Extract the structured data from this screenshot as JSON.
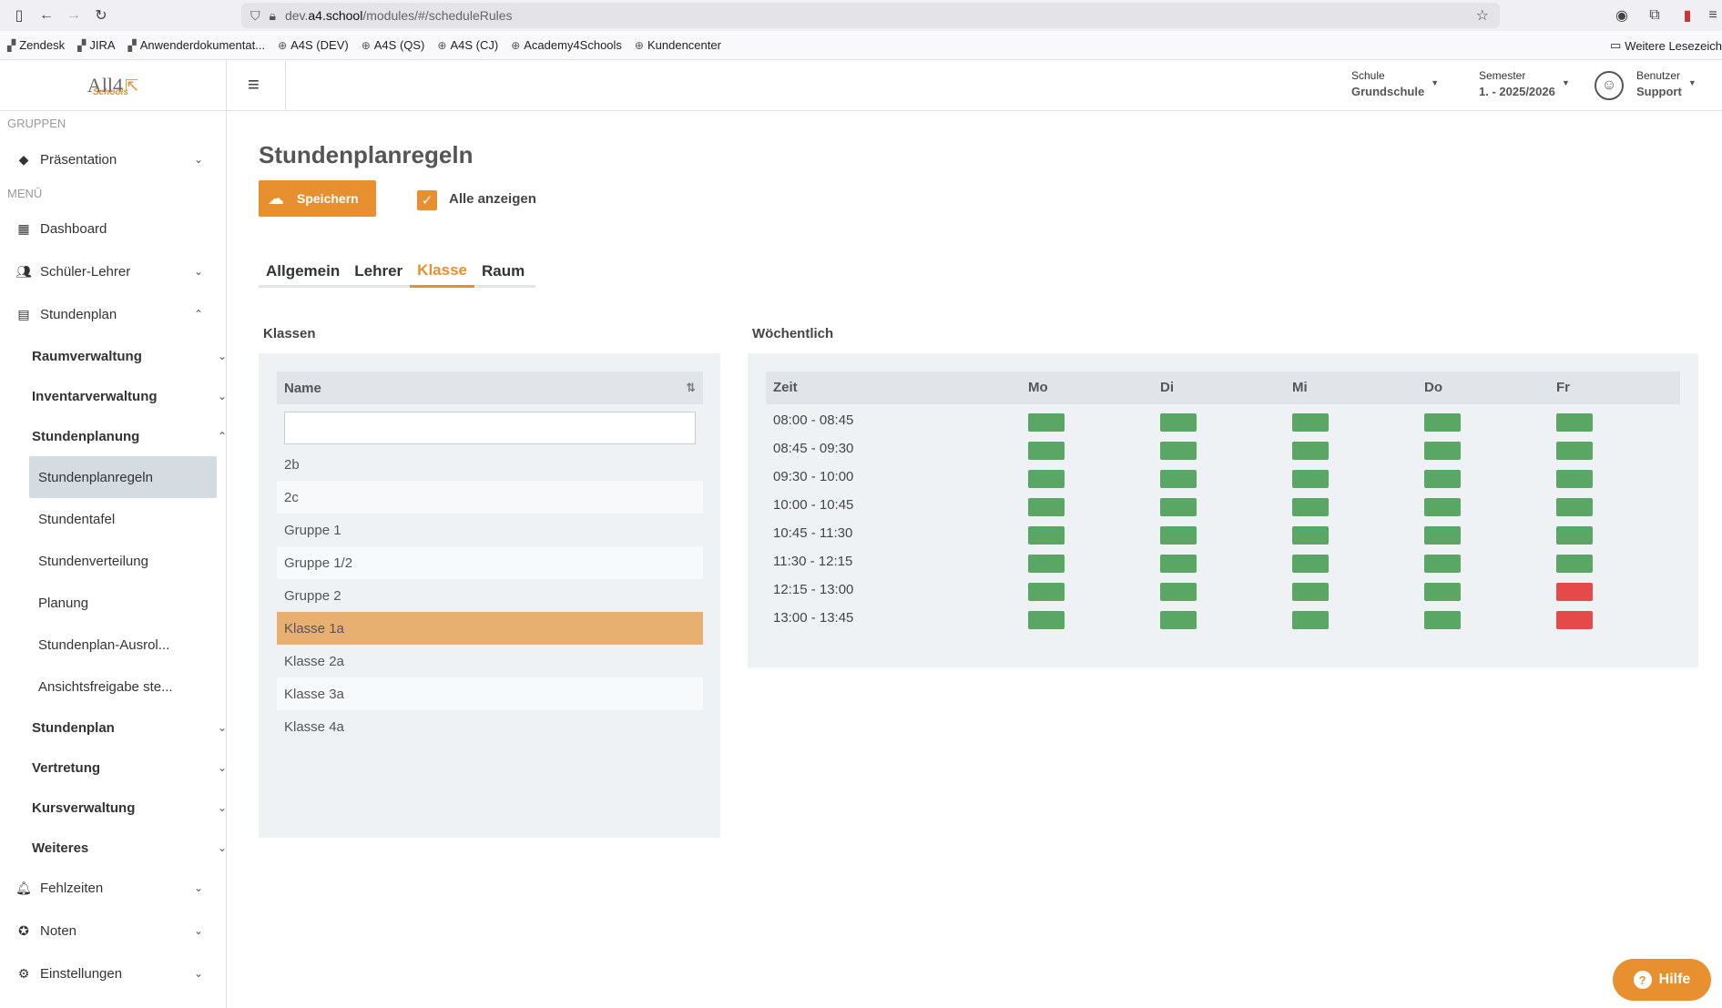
{
  "browser": {
    "url_prefix": "dev.",
    "url_host": "a4.school",
    "url_path": "/modules/#/scheduleRules",
    "bookmarks": [
      "Zendesk",
      "JIRA",
      "Anwenderdokumentat...",
      "A4S (DEV)",
      "A4S (QS)",
      "A4S (CJ)",
      "Academy4Schools",
      "Kundencenter"
    ],
    "more_bookmarks": "Weitere Lesezeich"
  },
  "header": {
    "logo_text": "All4",
    "logo_sub": "Schools",
    "school_label": "Schule",
    "school_value": "Grundschule",
    "semester_label": "Semester",
    "semester_value": "1. - 2025/2026",
    "user_label": "Benutzer",
    "user_value": "Support"
  },
  "sidebar": {
    "groups_title": "GRUPPEN",
    "group_item": "Präsentation",
    "menu_title": "MENÜ",
    "items": {
      "dashboard": "Dashboard",
      "schueler_lehrer": "Schüler-Lehrer",
      "stundenplan": "Stundenplan",
      "raumverwaltung": "Raumverwaltung",
      "inventarverwaltung": "Inventarverwaltung",
      "stundenplanung": "Stundenplanung",
      "stundenplanregeln": "Stundenplanregeln",
      "stundentafel": "Stundentafel",
      "stundenverteilung": "Stundenverteilung",
      "planung": "Planung",
      "ausrollen": "Stundenplan-Ausrol...",
      "ansichtsfreigabe": "Ansichtsfreigabe ste...",
      "stundenplan_sub": "Stundenplan",
      "vertretung": "Vertretung",
      "kursverwaltung": "Kursverwaltung",
      "weiteres": "Weiteres",
      "fehlzeiten": "Fehlzeiten",
      "noten": "Noten",
      "einstellungen": "Einstellungen"
    }
  },
  "main": {
    "title": "Stundenplanregeln",
    "save_label": "Speichern",
    "show_all_label": "Alle anzeigen",
    "show_all_checked": true,
    "tabs": [
      "Allgemein",
      "Lehrer",
      "Klasse",
      "Raum"
    ],
    "active_tab": "Klasse",
    "klassen": {
      "title": "Klassen",
      "column": "Name",
      "filter_value": "",
      "rows": [
        "2b",
        "2c",
        "Gruppe 1",
        "Gruppe 1/2",
        "Gruppe 2",
        "Klasse 1a",
        "Klasse 2a",
        "Klasse 3a",
        "Klasse 4a"
      ],
      "selected": "Klasse 1a"
    },
    "woechentlich": {
      "title": "Wöchentlich",
      "columns": [
        "Zeit",
        "Mo",
        "Di",
        "Mi",
        "Do",
        "Fr"
      ],
      "status_colors": {
        "available": "#5aa765",
        "blocked": "#e5494a"
      },
      "rows": [
        {
          "time": "08:00 - 08:45",
          "slots": [
            "available",
            "available",
            "available",
            "available",
            "available"
          ]
        },
        {
          "time": "08:45 - 09:30",
          "slots": [
            "available",
            "available",
            "available",
            "available",
            "available"
          ]
        },
        {
          "time": "09:30 - 10:00",
          "slots": [
            "available",
            "available",
            "available",
            "available",
            "available"
          ]
        },
        {
          "time": "10:00 - 10:45",
          "slots": [
            "available",
            "available",
            "available",
            "available",
            "available"
          ]
        },
        {
          "time": "10:45 - 11:30",
          "slots": [
            "available",
            "available",
            "available",
            "available",
            "available"
          ]
        },
        {
          "time": "11:30 - 12:15",
          "slots": [
            "available",
            "available",
            "available",
            "available",
            "available"
          ]
        },
        {
          "time": "12:15 - 13:00",
          "slots": [
            "available",
            "available",
            "available",
            "available",
            "blocked"
          ]
        },
        {
          "time": "13:00 - 13:45",
          "slots": [
            "available",
            "available",
            "available",
            "available",
            "blocked"
          ]
        }
      ]
    }
  },
  "help_label": "Hilfe",
  "accent_color": "#e8902f"
}
